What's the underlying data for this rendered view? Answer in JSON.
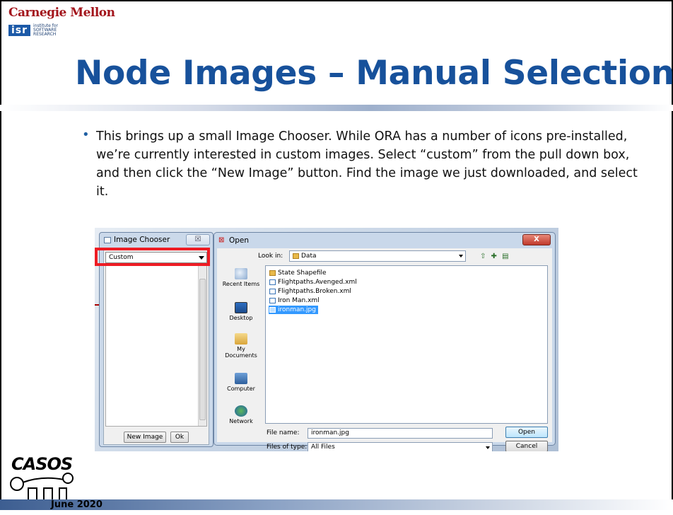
{
  "header": {
    "org": "Carnegie Mellon",
    "isr_mark": "isr",
    "isr_text": "institute for SOFTWARE RESEARCH"
  },
  "slide": {
    "title": "Node Images – Manual Selection",
    "bullet": "This brings up a small Image Chooser.  While ORA has a number of icons pre-installed, we’re currently interested in custom images.  Select “custom” from the pull down box, and then click the “New Image” button.  Find the image we just downloaded, and select it."
  },
  "image_chooser": {
    "title": "Image Chooser",
    "close_label": "☒",
    "selected_category": "Custom",
    "new_image_label": "New Image",
    "ok_label": "Ok"
  },
  "open_dialog": {
    "title": "Open",
    "close_label": "X",
    "look_in_label": "Look in:",
    "look_in_value": "Data",
    "places": [
      {
        "name": "recent-items",
        "label": "Recent Items",
        "icon": "recent-items-icon"
      },
      {
        "name": "desktop",
        "label": "Desktop",
        "icon": "desktop-icon"
      },
      {
        "name": "my-documents",
        "label": "My Documents",
        "icon": "documents-icon"
      },
      {
        "name": "computer",
        "label": "Computer",
        "icon": "computer-icon"
      },
      {
        "name": "network",
        "label": "Network",
        "icon": "network-icon"
      }
    ],
    "files": [
      {
        "name": "State Shapefile",
        "icon": "folder-icon"
      },
      {
        "name": "Flightpaths.Avenged.xml",
        "icon": "xml-file-icon"
      },
      {
        "name": "Flightpaths.Broken.xml",
        "icon": "xml-file-icon"
      },
      {
        "name": "Iron Man.xml",
        "icon": "xml-file-icon"
      },
      {
        "name": "ironman.jpg",
        "icon": "image-file-icon",
        "selected": true
      }
    ],
    "file_name_label": "File name:",
    "file_name_value": "ironman.jpg",
    "files_of_type_label": "Files of type:",
    "files_of_type_value": "All Files",
    "open_label": "Open",
    "cancel_label": "Cancel"
  },
  "footer": {
    "logo_text": "CASOS",
    "date": "June 2020"
  },
  "colors": {
    "title": "#17519b",
    "highlight": "#ee1c24",
    "cmu_red": "#a3151c"
  }
}
